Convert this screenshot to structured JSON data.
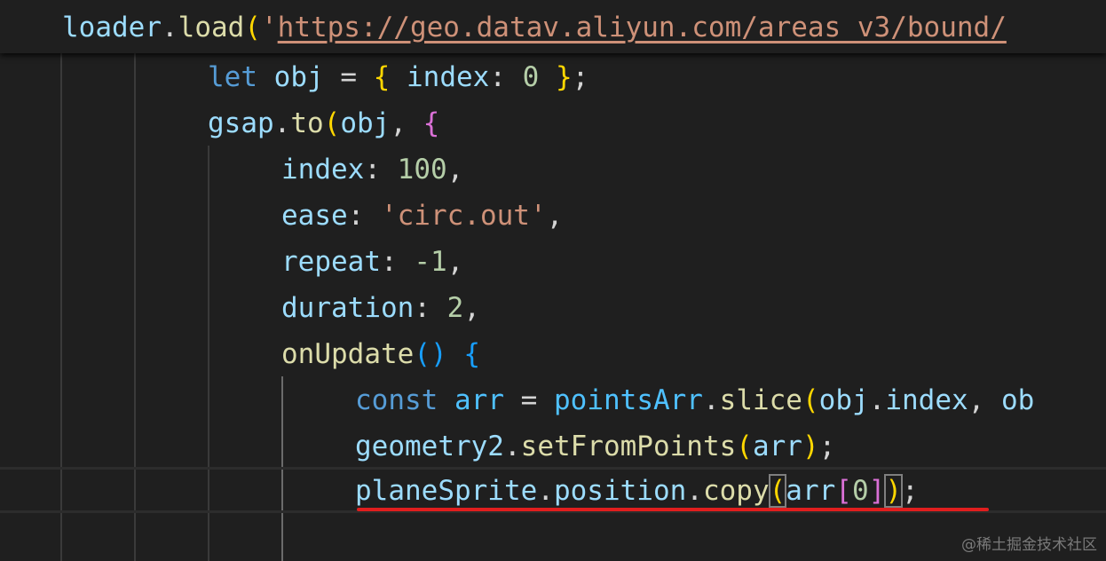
{
  "editor": {
    "sticky_line": {
      "obj": "loader",
      "dot": ".",
      "method": "load",
      "open_paren": "(",
      "quote": "'",
      "url": "https://geo.datav.aliyun.com/areas_v3/bound/"
    },
    "lines": [
      {
        "kw": "let",
        "sp1": " ",
        "name": "obj",
        "eq": " = ",
        "open": "{",
        "key": " index",
        "colon": ": ",
        "val": "0",
        "close": " }",
        "semi": ";"
      },
      {
        "obj": "gsap",
        "dot": ".",
        "fn": "to",
        "open_paren": "(",
        "arg": "obj",
        "comma": ", ",
        "open_brace": "{"
      },
      {
        "key": "index",
        "colon": ": ",
        "val": "100",
        "comma": ","
      },
      {
        "key": "ease",
        "colon": ": ",
        "val": "'circ.out'",
        "comma": ","
      },
      {
        "key": "repeat",
        "colon": ": ",
        "val": "-1",
        "comma": ","
      },
      {
        "key": "duration",
        "colon": ": ",
        "val": "2",
        "comma": ","
      },
      {
        "fn": "onUpdate",
        "parens": "()",
        "sp": " ",
        "open_brace": "{"
      },
      {
        "kw": "const",
        "sp": " ",
        "name": "arr",
        "eq": " = ",
        "obj": "pointsArr",
        "dot": ".",
        "fn": "slice",
        "open_paren": "(",
        "arg_obj": "obj",
        "arg_dot": ".",
        "arg_prop": "index",
        "comma": ", ",
        "trail": "ob"
      },
      {
        "obj": "geometry2",
        "dot": ".",
        "fn": "setFromPoints",
        "open_paren": "(",
        "arg": "arr",
        "close_paren": ")",
        "semi": ";"
      },
      {
        "obj": "planeSprite",
        "dot1": ".",
        "prop": "position",
        "dot2": ".",
        "fn": "copy",
        "open_paren": "(",
        "arg": "arr",
        "open_bracket": "[",
        "idx": "0",
        "close_bracket": "]",
        "close_paren": ")",
        "semi": ";"
      }
    ]
  },
  "watermark": "@稀土掘金技术社区"
}
